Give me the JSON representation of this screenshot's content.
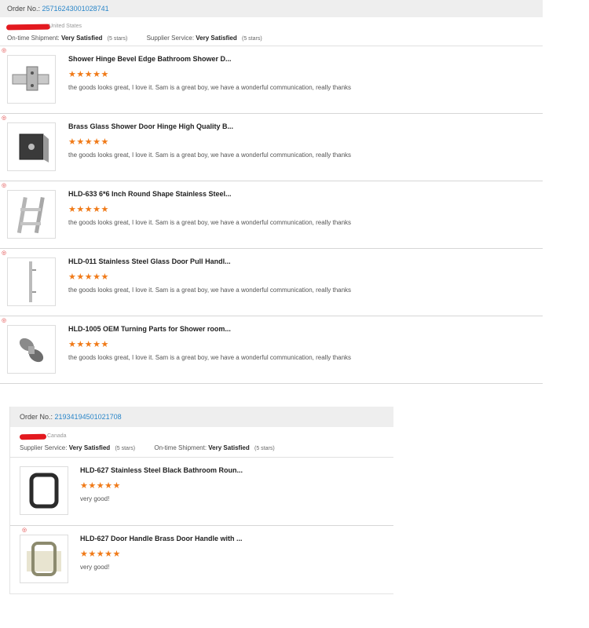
{
  "orders": [
    {
      "order_label": "Order No.:",
      "order_number": "25716243001028741",
      "country": "United States",
      "stats": [
        {
          "label": "On-time Shipment:",
          "value": "Very Satisfied",
          "stars": "(5 stars)"
        },
        {
          "label": "Supplier Service:",
          "value": "Very Satisfied",
          "stars": "(5 stars)"
        }
      ],
      "items": [
        {
          "title": "Shower Hinge Bevel Edge Bathroom Shower D...",
          "rating": 5,
          "stars": "★★★★★",
          "comment": "the goods looks great, I love it. Sam is a great boy, we have a wonderful communication, really thanks",
          "image_icon": "hinge-icon"
        },
        {
          "title": "Brass Glass Shower Door Hinge High Quality B...",
          "rating": 5,
          "stars": "★★★★★",
          "comment": "the goods looks great, I love it. Sam is a great boy, we have a wonderful communication, really thanks",
          "image_icon": "square-hinge-icon"
        },
        {
          "title": "HLD-633 6*6 Inch Round Shape Stainless Steel...",
          "rating": 5,
          "stars": "★★★★★",
          "comment": "the goods looks great, I love it. Sam is a great boy, we have a wonderful communication, really thanks",
          "image_icon": "pull-handle-icon"
        },
        {
          "title": "HLD-011 Stainless Steel Glass Door Pull Handl...",
          "rating": 5,
          "stars": "★★★★★",
          "comment": "the goods looks great, I love it. Sam is a great boy, we have a wonderful communication, really thanks",
          "image_icon": "long-handle-icon"
        },
        {
          "title": "HLD-1005 OEM Turning Parts for Shower room...",
          "rating": 5,
          "stars": "★★★★★",
          "comment": "the goods looks great, I love it. Sam is a great boy, we have a wonderful communication, really thanks",
          "image_icon": "clamp-icon"
        }
      ]
    },
    {
      "order_label": "Order No.:",
      "order_number": "21934194501021708",
      "country": "Canada",
      "stats": [
        {
          "label": "Supplier Service:",
          "value": "Very Satisfied",
          "stars": "(5 stars)"
        },
        {
          "label": "On-time Shipment:",
          "value": "Very Satisfied",
          "stars": "(5 stars)"
        }
      ],
      "items": [
        {
          "title": "HLD-627 Stainless Steel Black Bathroom Roun...",
          "rating": 5,
          "stars": "★★★★★",
          "comment": "very good!",
          "image_icon": "black-handle-icon"
        },
        {
          "title": "HLD-627 Door Handle Brass Door Handle with ...",
          "rating": 5,
          "stars": "★★★★★",
          "comment": "very good!",
          "image_icon": "brass-handle-icon"
        }
      ]
    }
  ],
  "colors": {
    "accent_link": "#2a86c9",
    "star": "#f07a18",
    "redaction": "#e3191f",
    "header_bg": "#eeeeee"
  }
}
